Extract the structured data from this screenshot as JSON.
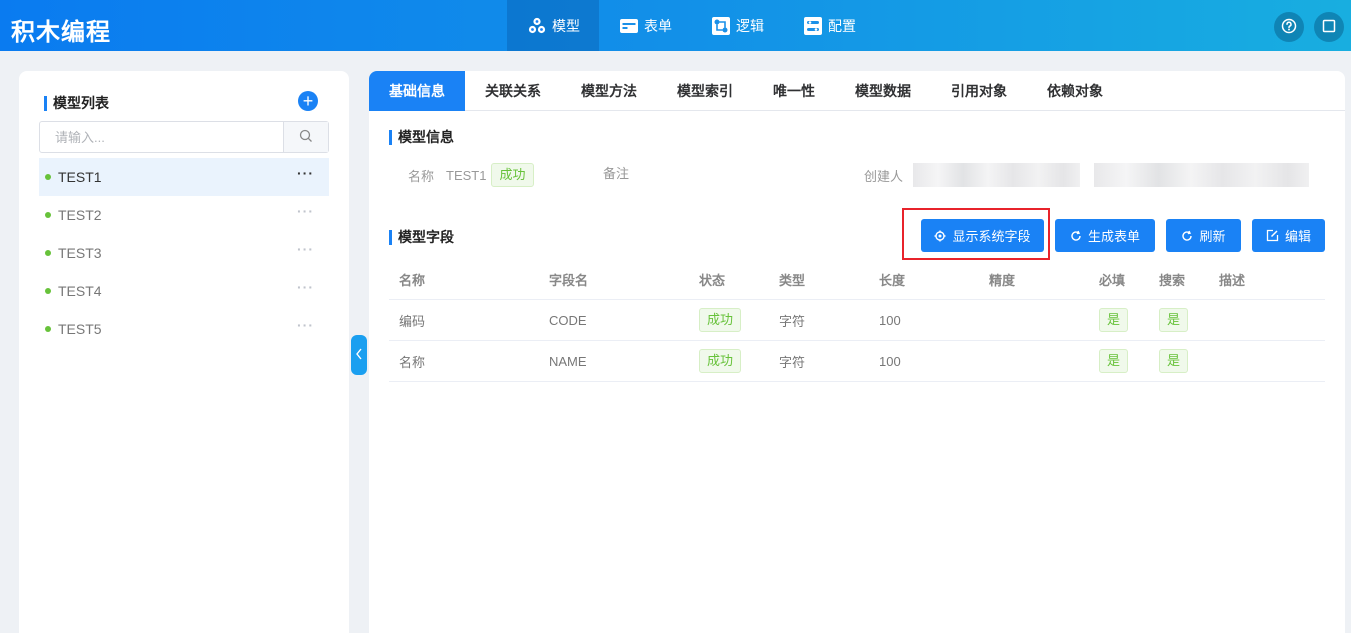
{
  "app": {
    "title": "积木编程"
  },
  "nav": [
    {
      "label": "模型",
      "icon": "cubes-icon",
      "active": true
    },
    {
      "label": "表单",
      "icon": "form-card-icon",
      "active": false
    },
    {
      "label": "逻辑",
      "icon": "logic-flow-icon",
      "active": false
    },
    {
      "label": "配置",
      "icon": "config-toggle-icon",
      "active": false
    }
  ],
  "header_actions": [
    {
      "icon": "help-icon"
    },
    {
      "icon": "fullscreen-icon"
    }
  ],
  "sidebar": {
    "title": "模型列表",
    "search_placeholder": "请输入...",
    "items": [
      {
        "label": "TEST1",
        "active": true
      },
      {
        "label": "TEST2",
        "active": false
      },
      {
        "label": "TEST3",
        "active": false
      },
      {
        "label": "TEST4",
        "active": false
      },
      {
        "label": "TEST5",
        "active": false
      }
    ]
  },
  "tabs": [
    "基础信息",
    "关联关系",
    "模型方法",
    "模型索引",
    "唯一性",
    "模型数据",
    "引用对象",
    "依赖对象"
  ],
  "model_info": {
    "title": "模型信息",
    "name_label": "名称",
    "name_value": "TEST1",
    "status": "成功",
    "remark_label": "备注",
    "creator_label": "创建人"
  },
  "fields": {
    "title": "模型字段",
    "buttons": {
      "show_system": "显示系统字段",
      "generate_form": "生成表单",
      "refresh": "刷新",
      "edit": "编辑"
    },
    "columns": [
      "名称",
      "字段名",
      "状态",
      "类型",
      "长度",
      "精度",
      "必填",
      "搜索",
      "描述"
    ],
    "rows": [
      {
        "name": "编码",
        "field": "CODE",
        "status": "成功",
        "type": "字符",
        "length": "100",
        "precision": "",
        "required": "是",
        "search": "是",
        "desc": ""
      },
      {
        "name": "名称",
        "field": "NAME",
        "status": "成功",
        "type": "字符",
        "length": "100",
        "precision": "",
        "required": "是",
        "search": "是",
        "desc": ""
      }
    ]
  },
  "colors": {
    "primary": "#1a82f5",
    "success": "#67c23a",
    "highlight": "#e8232b"
  }
}
